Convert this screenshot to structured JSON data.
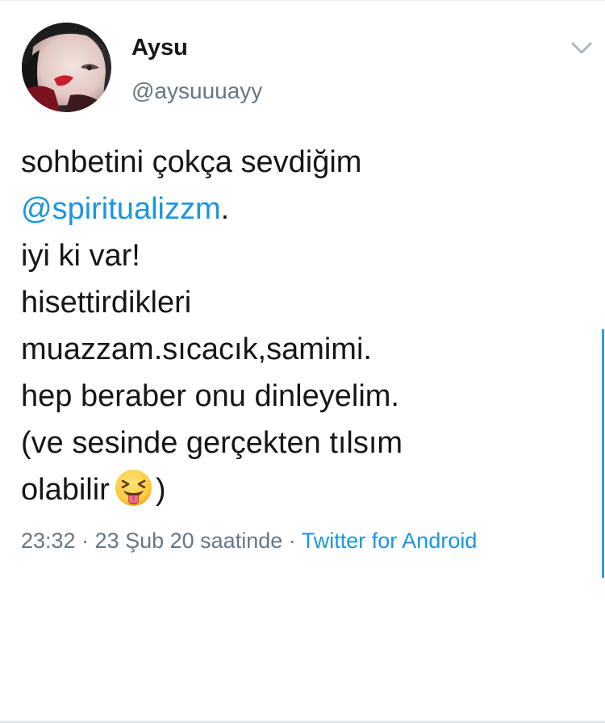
{
  "user": {
    "display_name": "Aysu",
    "handle": "@aysuuuayy"
  },
  "tweet": {
    "line1": "sohbetini çokça sevdiğim",
    "mention": "@spiritualizzm",
    "mention_suffix": ".",
    "line3": "iyi ki var!",
    "line4": "hisettirdikleri",
    "line5": "muazzam.sıcacık,samimi.",
    "line6": "hep beraber onu dinleyelim.",
    "line7": "(ve sesinde gerçekten tılsım",
    "line8_before_emoji": "olabilir",
    "emoji_name": "squinting-face-with-tongue",
    "line8_after_emoji": ")"
  },
  "meta": {
    "timestamp": "23:32 · 23 Şub 20 saatinde · ",
    "source": "Twitter for Android"
  },
  "colors": {
    "link": "#1b95e0",
    "secondary_text": "#657786",
    "primary_text": "#14171a",
    "scroll_indicator": "#1da1f2"
  },
  "icons": {
    "menu": "chevron-down-icon",
    "avatar": "profile-photo"
  }
}
